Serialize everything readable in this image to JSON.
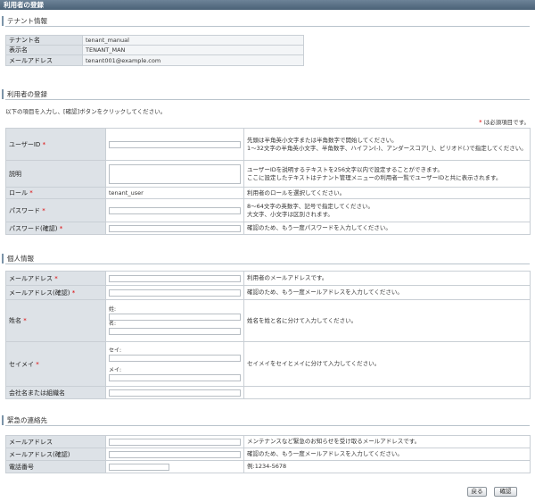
{
  "title": "利用者の登録",
  "tenant_section": {
    "title": "テナント情報",
    "rows": [
      {
        "label": "テナント名",
        "value": "tenant_manual"
      },
      {
        "label": "表示名",
        "value": "TENANT_MAN"
      },
      {
        "label": "メールアドレス",
        "value": "tenant001@example.com"
      }
    ]
  },
  "user_section": {
    "title": "利用者の登録",
    "instruction": "以下の項目を入力し、[確認]ボタンをクリックしてください。",
    "required_note": "は必須項目です。",
    "required_mark": "*",
    "user_id": {
      "label": "ユーザーID",
      "hint1": "先頭は半角英小文字または半角数字で開始してください。",
      "hint2": "1～32文字の半角英小文字、半角数字、ハイフン(-)、アンダースコア(_)、ピリオド(.)で指定してください。"
    },
    "description": {
      "label": "説明",
      "hint1": "ユーザーIDを説明するテキストを256文字以内で設定することができます。",
      "hint2": "ここに設定したテキストはテナント管理メニューの利用者一覧でユーザーIDと共に表示されます。"
    },
    "role": {
      "label": "ロール",
      "value": "tenant_user",
      "hint": "利用者のロールを選択してください。"
    },
    "password": {
      "label": "パスワード",
      "hint1": "8～64文字の英数字、記号で指定してください。",
      "hint2": "大文字、小文字は区別されます。"
    },
    "password_confirm": {
      "label": "パスワード(確認)",
      "hint": "確認のため、もう一度パスワードを入力してください。"
    }
  },
  "personal_section": {
    "title": "個人情報",
    "email": {
      "label": "メールアドレス",
      "hint": "利用者のメールアドレスです。"
    },
    "email_confirm": {
      "label": "メールアドレス(確認)",
      "hint": "確認のため、もう一度メールアドレスを入力してください。"
    },
    "name": {
      "label": "姓名",
      "last": "姓:",
      "first": "名:",
      "hint": "姓名を姓と名に分けて入力してください。"
    },
    "kana": {
      "label": "セイメイ",
      "last": "セイ:",
      "first": "メイ:",
      "hint": "セイメイをセイとメイに分けて入力してください。"
    },
    "company": {
      "label": "会社名または組織名"
    }
  },
  "emergency_section": {
    "title": "緊急の連絡先",
    "email": {
      "label": "メールアドレス",
      "hint": "メンテナンスなど緊急のお知らせを受け取るメールアドレスです。"
    },
    "email_confirm": {
      "label": "メールアドレス(確認)",
      "hint": "確認のため、もう一度メールアドレスを入力してください。"
    },
    "phone": {
      "label": "電話番号",
      "hint": "例:1234-5678"
    }
  },
  "buttons": {
    "back": "戻る",
    "confirm": "確認"
  }
}
